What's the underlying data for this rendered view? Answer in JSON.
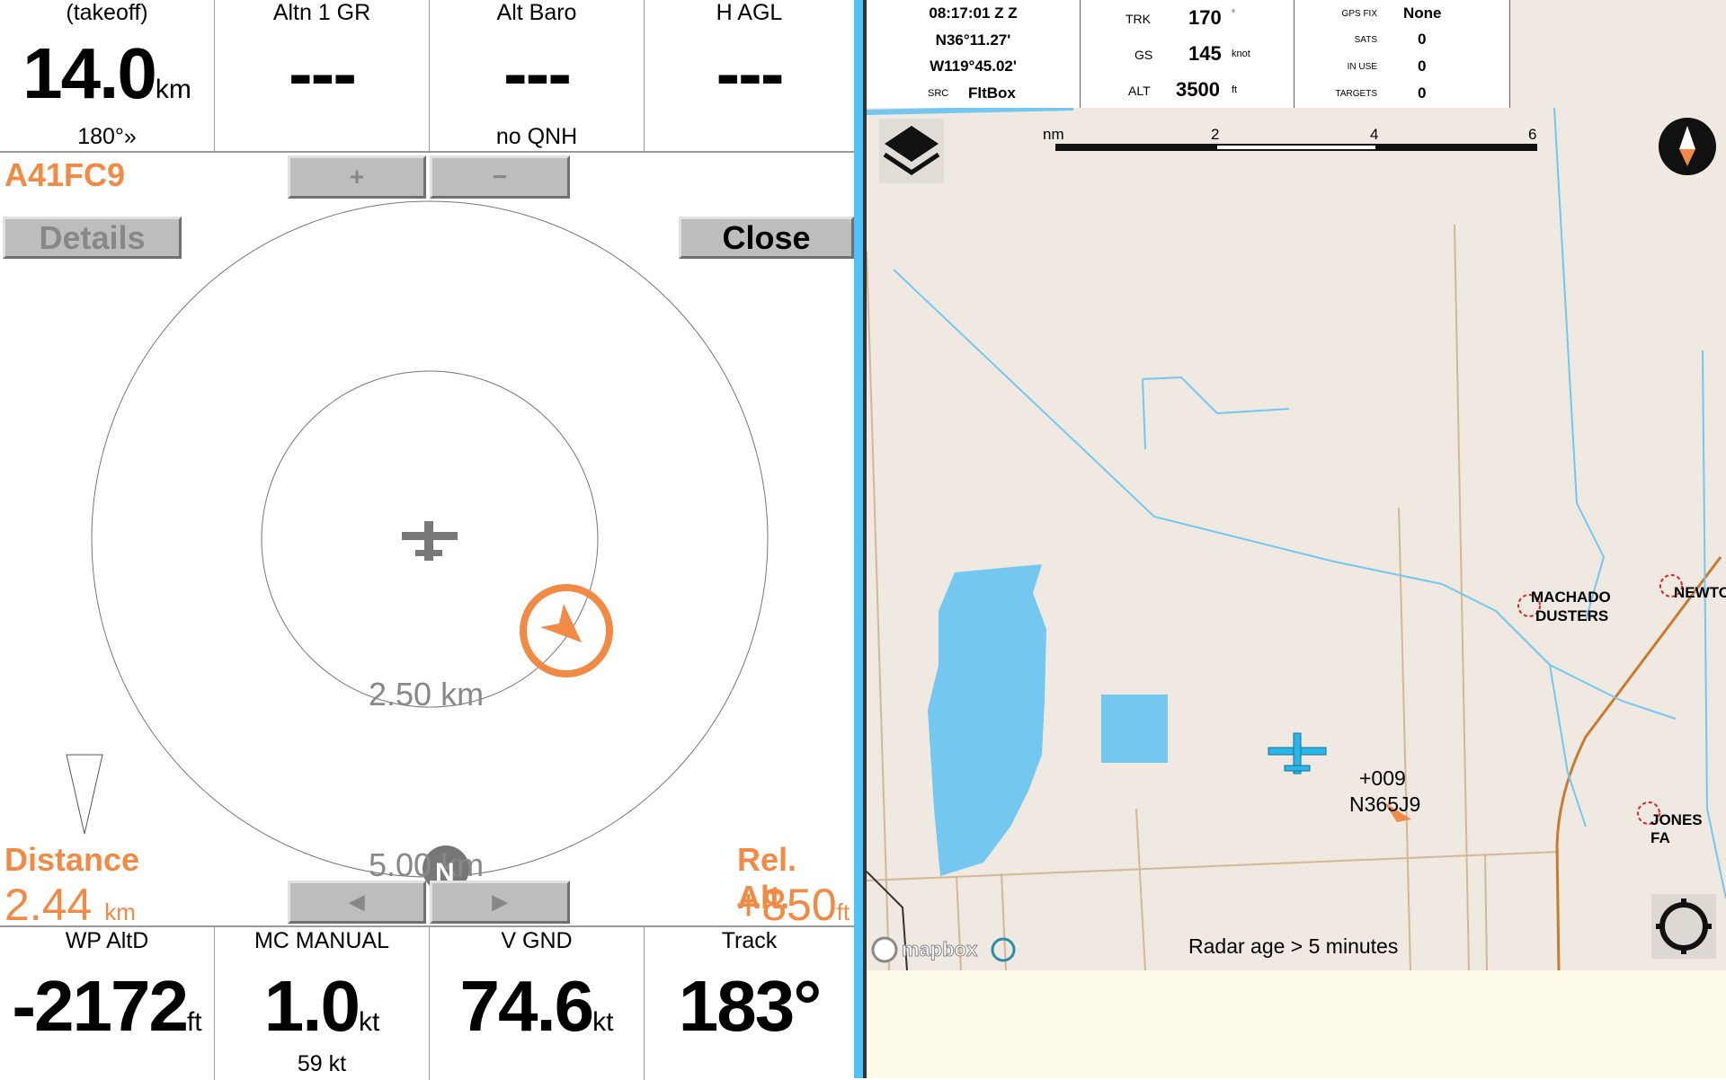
{
  "top_cells": [
    {
      "title": "(takeoff)",
      "value": "14.0",
      "unit": "km",
      "sub": "180°»"
    },
    {
      "title": "Altn 1 GR",
      "value": "---",
      "unit": "",
      "sub": ""
    },
    {
      "title": "Alt Baro",
      "value": "---",
      "unit": "",
      "sub": "no QNH"
    },
    {
      "title": "H AGL",
      "value": "---",
      "unit": "",
      "sub": ""
    }
  ],
  "bottom_cells": [
    {
      "title": "WP AltD",
      "value": "-2172",
      "unit": "ft",
      "sub": ""
    },
    {
      "title": "MC MANUAL",
      "value": "1.0",
      "unit": "kt",
      "sub": "59 kt"
    },
    {
      "title": "V GND",
      "value": "74.6",
      "unit": "kt",
      "sub": ""
    },
    {
      "title": "Track",
      "value": "183°",
      "unit": "",
      "sub": ""
    }
  ],
  "traffic": {
    "id": "A41FC9",
    "zoom_in": "+",
    "zoom_out": "−",
    "details": "Details",
    "close": "Close",
    "ring_inner": "2.50 km",
    "ring_outer": "5.00 km",
    "north": "N",
    "prev": "◀",
    "next": "▶",
    "distance_label": "Distance",
    "distance_value": "2.44",
    "distance_unit": "km",
    "relalt_label": "Rel. Alt.",
    "relalt_value": "+850",
    "relalt_unit": "ft",
    "accent": "#f08a45"
  },
  "map_header": {
    "time": "08:17:01 Z Z",
    "lat": "N36°11.27'",
    "lon": "W119°45.02'",
    "src_label": "SRC",
    "src": "FltBox",
    "trk_label": "TRK",
    "trk": "170",
    "trk_unit": "°",
    "gs_label": "GS",
    "gs": "145",
    "gs_unit": "knot",
    "alt_label": "ALT",
    "alt": "3500",
    "alt_unit": "ft",
    "gpsfix_label": "GPS FIX",
    "gpsfix": "None",
    "sats_label": "SATS",
    "sats": "0",
    "inuse_label": "IN USE",
    "inuse": "0",
    "targets_label": "TARGETS",
    "targets": "0"
  },
  "map": {
    "scale_unit": "nm",
    "scale_ticks": [
      "2",
      "4",
      "6"
    ],
    "places": [
      "MACHADO",
      "DUSTERS",
      "NEWTO",
      "JONES FA"
    ],
    "traffic_alt": "+009",
    "traffic_reg": "N365J9",
    "radar_age": "Radar age > 5 minutes",
    "attribution": "mapbox",
    "water_color": "#74c7ef",
    "land_color": "#efe9e1"
  }
}
